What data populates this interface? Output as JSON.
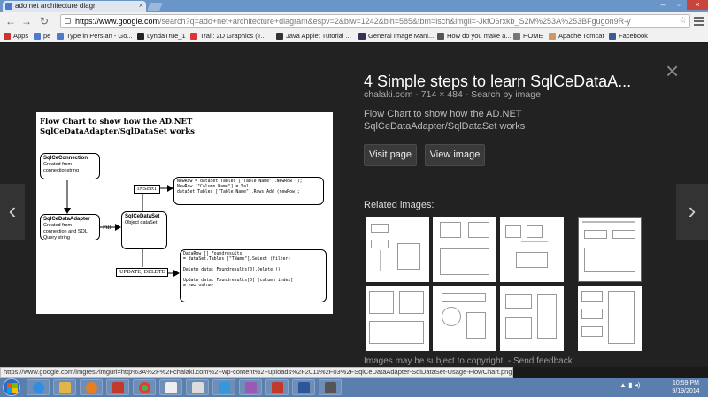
{
  "browser": {
    "tab_title": "ado net architecture diagr",
    "url_host": "https://www.google.com",
    "url_path": "/search?q=ado+net+architecture+diagram&espv=2&biw=1242&bih=585&tbm=isch&imgil=-JkfO6rxkb_S2M%253A%253BFgugon9R-y",
    "bookmarks": [
      "Apps",
      "pe",
      "Type in Persian - Go...",
      "LyndaTrue_1",
      "Trail: 2D Graphics (T...",
      "Java Applet Tutorial ...",
      "General Image Mani...",
      "How do you make a...",
      "HOME",
      "Apache Tomcat",
      "Facebook"
    ]
  },
  "viewer": {
    "title": "4 Simple steps to learn SqlCeDataA...",
    "site": "chalaki.com",
    "size": "714 × 484",
    "search_by_image": "Search by image",
    "description": "Flow Chart to show how the AD.NET SqlCeDataAdapter/SqlDataSet works",
    "visit_page": "Visit page",
    "view_image": "View image",
    "related_heading": "Related images:",
    "footer_notice": "Images may be subject to copyright.",
    "footer_feedback": "Send feedback"
  },
  "preview": {
    "heading": "Flow Chart to show how the AD.NET SqlCeDataAdapter/SqlDataSet works",
    "box_connection_title": "SqlCeConnection",
    "box_connection_text": "Created from connectionstring",
    "box_adapter_title": "SqlCeDataAdapter",
    "box_adapter_text": "Created from connection and SQL Query string",
    "fill_label": "Fill",
    "box_dataset_title": "SqlCeDataSet",
    "box_dataset_text": "Object dataSet",
    "insert_label": "INSERT",
    "update_label": "UPDATE, DELETE",
    "insert_code": "NewRow = dataSet.Tables [\"Table Name\"].NewRow ();\nNewRow [\"Column Name\"] = Val;\ndataSet.Tables [\"Table Name\"].Rows.Add (newRow);",
    "update_code": "DataRow [] Foundresults\n= dataSet.Tables [\"TName\"].Select (filter)\n\nDelete data: Foundresults[0].Delete ()\n\nUpdate data: Foundresults[0] [column index]\n= new value;"
  },
  "status_url": "https://www.google.com/imgres?imgurl=http%3A%2F%2Fchalaki.com%2Fwp-content%2Fuploads%2F2011%2F03%2FSqlCeDataAdapter-SqlDataSet-Usage-FlowChart.png&imgrefurl=http%3A%2F%2Fchalaki.com%2Fusing-sqlcedataadapter-and-sql...",
  "clock": {
    "time": "10:59 PM",
    "date": "9/19/2014"
  },
  "colors": {
    "accent": "#6a95c9",
    "bg": "#222222",
    "taskbar": "#5a7fae"
  }
}
